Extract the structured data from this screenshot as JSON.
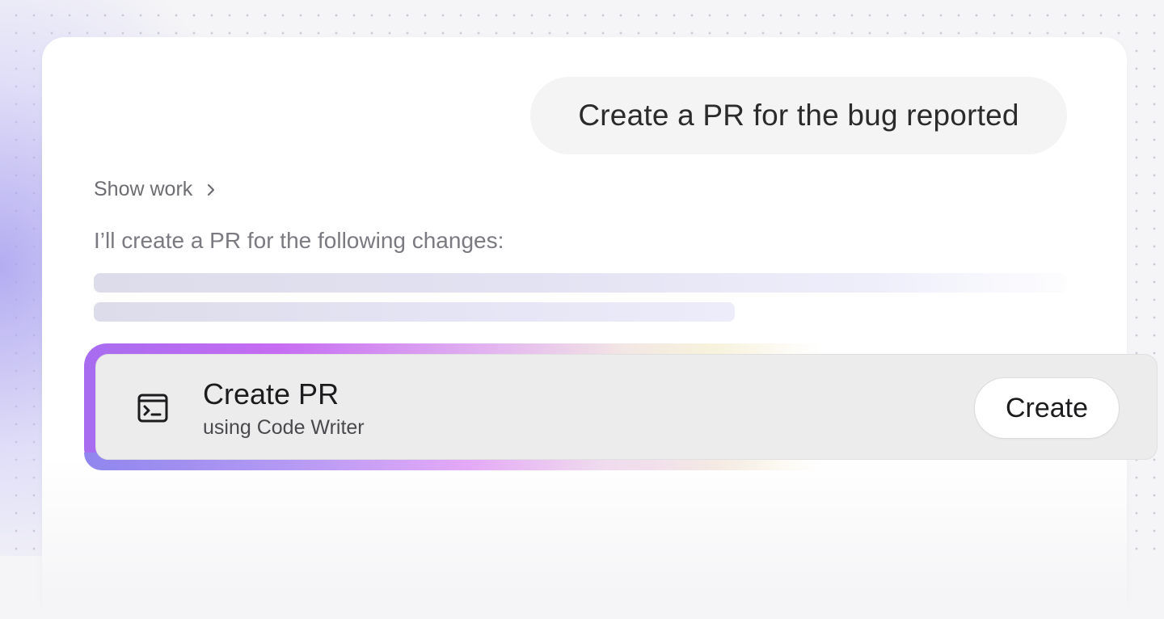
{
  "chat": {
    "user_message": "Create a PR for the bug reported",
    "show_work_label": "Show work",
    "show_work_icon": "chevron-right-icon",
    "assistant_reply": "I’ll create a PR for the following changes:"
  },
  "action": {
    "icon": "terminal-icon",
    "title": "Create PR",
    "subtitle": "using Code Writer",
    "button_label": "Create"
  },
  "colors": {
    "accent_purple": "#a76cf0",
    "accent_pink": "#e3b6f0",
    "background": "#f5f5f7",
    "bubble": "#f4f4f4"
  }
}
